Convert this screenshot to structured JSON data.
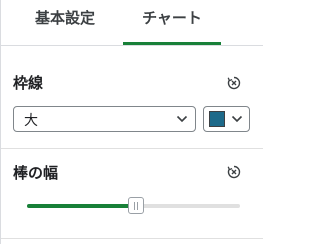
{
  "tabs": [
    {
      "label": "基本設定",
      "active": false
    },
    {
      "label": "チャート",
      "active": true
    }
  ],
  "border_section": {
    "title": "枠線",
    "reset_icon": "reset-x-icon",
    "select": {
      "value": "大"
    },
    "color": {
      "value": "#1d6a8a"
    }
  },
  "bar_width_section": {
    "title": "棒の幅",
    "reset_icon": "reset-x-icon",
    "slider": {
      "value": 0.51
    }
  },
  "colors": {
    "accent": "#188038",
    "border": "#80868b"
  }
}
